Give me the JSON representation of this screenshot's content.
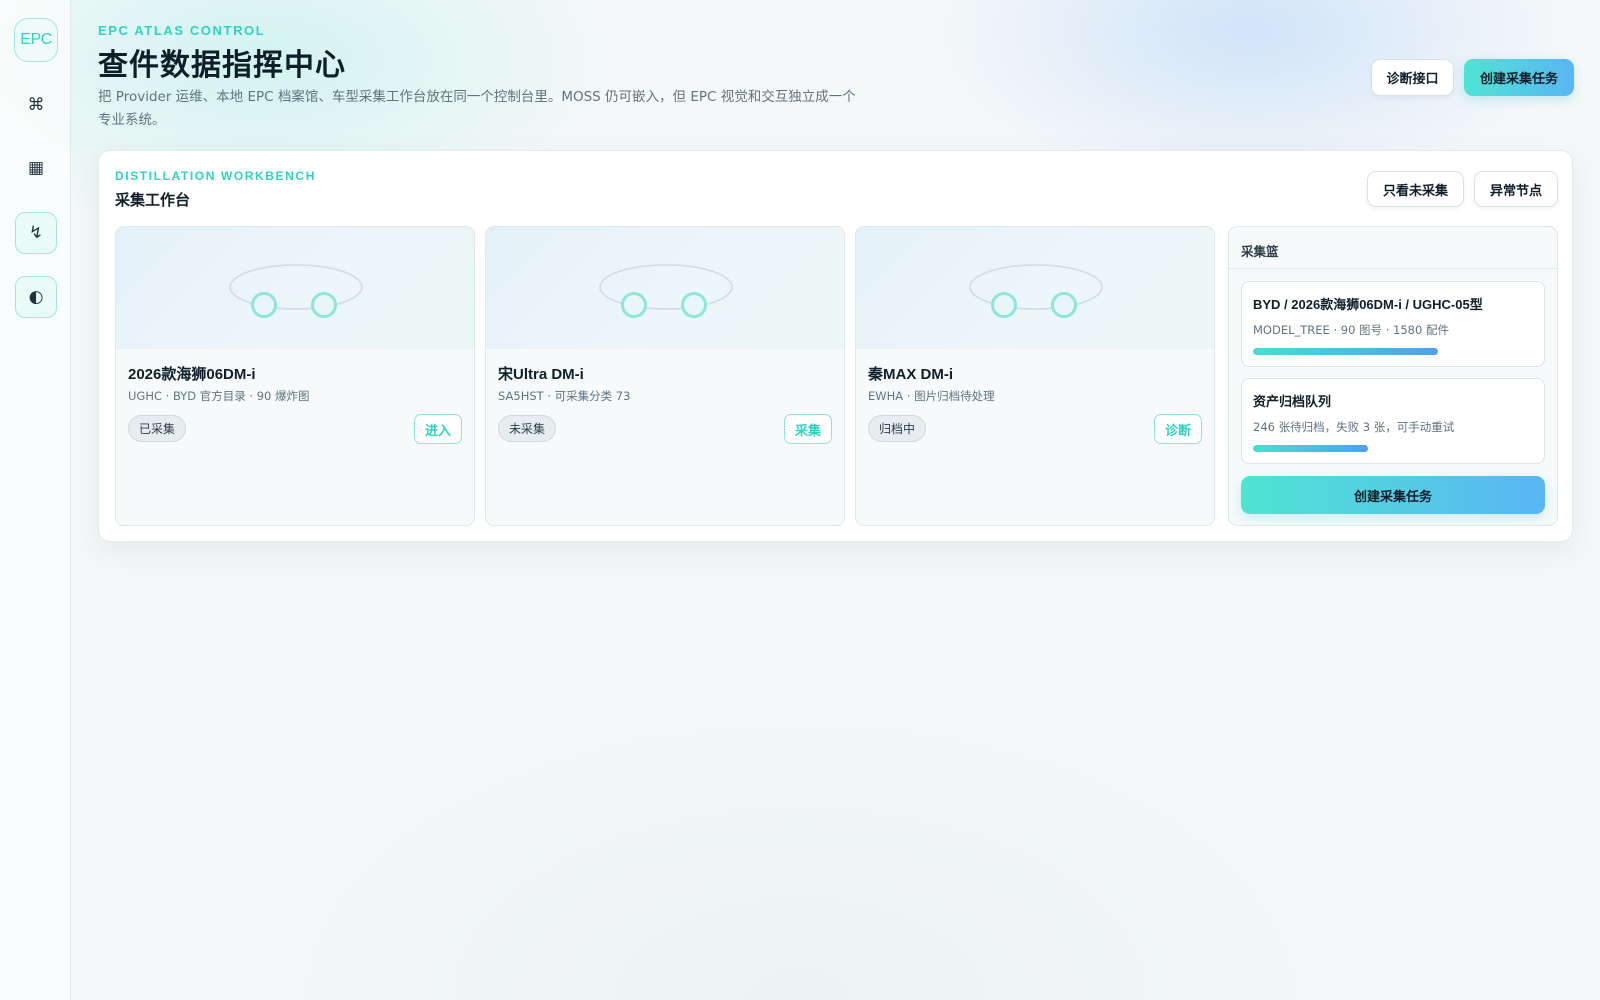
{
  "sidebar": {
    "logo": "EPC",
    "items": [
      {
        "glyph": "⌘",
        "icon": "command-icon"
      },
      {
        "glyph": "▦",
        "icon": "grid-icon"
      },
      {
        "glyph": "↯",
        "icon": "bolt-icon"
      },
      {
        "glyph": "◐",
        "icon": "theme-toggle-icon"
      }
    ]
  },
  "header": {
    "eyebrow": "EPC ATLAS CONTROL",
    "title": "查件数据指挥中心",
    "description": "把 Provider 运维、本地 EPC 档案馆、车型采集工作台放在同一个控制台里。MOSS 仍可嵌入，但 EPC 视觉和交互独立成一个专业系统。",
    "diagnose_label": "诊断接口",
    "create_label": "创建采集任务"
  },
  "workbench": {
    "eyebrow": "DISTILLATION WORKBENCH",
    "title": "采集工作台",
    "filter_uncollected": "只看未采集",
    "filter_abnormal": "异常节点",
    "cards": [
      {
        "name": "2026款海狮06DM-i",
        "meta": "UGHC · BYD 官方目录 · 90 爆炸图",
        "status": "已采集",
        "action": "进入"
      },
      {
        "name": "宋Ultra DM-i",
        "meta": "SA5HST · 可采集分类 73",
        "status": "未采集",
        "action": "采集"
      },
      {
        "name": "秦MAX DM-i",
        "meta": "EWHA · 图片归档待处理",
        "status": "归档中",
        "action": "诊断"
      }
    ]
  },
  "basket": {
    "title": "采集篮",
    "jobs": [
      {
        "title": "BYD / 2026款海狮06DM-i / UGHC-05型",
        "sub": "MODEL_TREE · 90 图号 · 1580 配件",
        "progress": 0.66
      },
      {
        "title": "资产归档队列",
        "sub": "246 张待归档，失败 3 张，可手动重试",
        "progress": 0.41
      }
    ],
    "cta_label": "创建采集任务"
  },
  "colors": {
    "accent": "#2fd3c0",
    "gradient_start": "#4fe4d2",
    "gradient_end": "#59b6f4",
    "text": "#0f1f2a",
    "muted": "#5f7480"
  }
}
